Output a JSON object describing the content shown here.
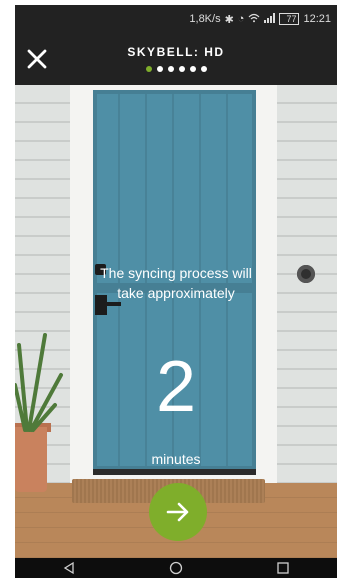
{
  "status_bar": {
    "speed": "1,8K/s",
    "battery": "77",
    "time": "12:21"
  },
  "header": {
    "title": "SKYBELL",
    "title_suffix": "HD",
    "step_total": 6,
    "step_current": 1,
    "accent_color": "#7fae2b",
    "close_icon": "close-icon"
  },
  "main": {
    "message_top": "The syncing process will take approximately",
    "duration_value": "2",
    "duration_unit": "minutes"
  },
  "actions": {
    "next_icon": "arrow-right-icon"
  },
  "nav_bar": {
    "icons": [
      "back-icon",
      "home-icon",
      "recents-icon"
    ]
  }
}
